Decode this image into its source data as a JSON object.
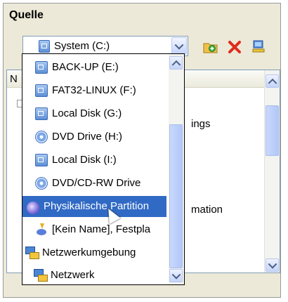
{
  "group": {
    "title": "Quelle"
  },
  "combo": {
    "selected": "System (C:)"
  },
  "toolbar": {
    "icons": [
      "add-folder-icon",
      "delete-icon",
      "network-computer-icon"
    ]
  },
  "listview": {
    "header_fragment": "N",
    "rows": [
      {
        "text": "ings"
      },
      {
        "text": "mation"
      }
    ]
  },
  "dropdown": {
    "items": [
      {
        "label": "BACK-UP (E:)",
        "icon": "disk-icon"
      },
      {
        "label": "FAT32-LINUX (F:)",
        "icon": "disk-icon"
      },
      {
        "label": "Local Disk (G:)",
        "icon": "disk-icon"
      },
      {
        "label": "DVD Drive (H:)",
        "icon": "cd-icon"
      },
      {
        "label": "Local Disk (I:)",
        "icon": "disk-icon"
      },
      {
        "label": "DVD/CD-RW Drive",
        "icon": "cd-icon"
      },
      {
        "label": "Physikalische Partition",
        "icon": "partition-icon",
        "selected": true
      },
      {
        "label": "[Kein Name], Festpla",
        "icon": "noname-icon"
      },
      {
        "label": "Netzwerkumgebung",
        "icon": "network-icon"
      },
      {
        "label": "Netzwerk",
        "icon": "network-icon"
      }
    ]
  },
  "colors": {
    "selection": "#316AC5",
    "panel": "#ECE9D8",
    "border": "#7F9DB9"
  }
}
